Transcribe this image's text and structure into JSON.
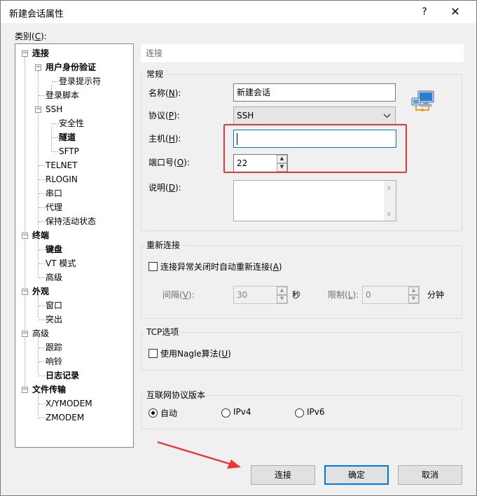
{
  "window": {
    "title": "新建会话属性",
    "help": "?",
    "close": "✕"
  },
  "category_label": {
    "text": "类别(",
    "key": "C",
    "tail": "):"
  },
  "tree": {
    "connection": "连接",
    "auth": "用户身份验证",
    "login_prompt": "登录提示符",
    "login_script": "登录脚本",
    "ssh": "SSH",
    "security": "安全性",
    "tunnel": "隧道",
    "sftp": "SFTP",
    "telnet": "TELNET",
    "rlogin": "RLOGIN",
    "serial": "串口",
    "proxy": "代理",
    "keepalive": "保持活动状态",
    "terminal": "终端",
    "keyboard": "键盘",
    "vt_mode": "VT 模式",
    "advanced1": "高级",
    "appearance": "外观",
    "window": "窗口",
    "highlight": "突出",
    "advanced2": "高级",
    "trace": "跟踪",
    "bell": "响铃",
    "logging": "日志记录",
    "file_transfer": "文件传输",
    "xymodem": "X/YMODEM",
    "zmodem": "ZMODEM"
  },
  "panel": {
    "header": "连接",
    "general": {
      "title": "常规",
      "name_label": {
        "text": "名称(",
        "key": "N",
        "tail": "):"
      },
      "name_value": "新建会话",
      "protocol_label": {
        "text": "协议(",
        "key": "P",
        "tail": "):"
      },
      "protocol_value": "SSH",
      "host_label": {
        "text": "主机(",
        "key": "H",
        "tail": "):"
      },
      "host_value": "",
      "port_label": {
        "text": "端口号(",
        "key": "O",
        "tail": "):"
      },
      "port_value": "22",
      "desc_label": {
        "text": "说明(",
        "key": "D",
        "tail": "):"
      },
      "desc_value": ""
    },
    "reconnect": {
      "title": "重新连接",
      "checkbox_label": {
        "text": "连接异常关闭时自动重新连接(",
        "key": "A",
        "tail": ")"
      },
      "checked": false,
      "interval_label": {
        "text": "间隔(",
        "key": "V",
        "tail": "):"
      },
      "interval_value": "30",
      "interval_unit": "秒",
      "limit_label": {
        "text": "限制(",
        "key": "L",
        "tail": "):"
      },
      "limit_value": "0",
      "limit_unit": "分钟"
    },
    "tcp": {
      "title": "TCP选项",
      "nagle_label": {
        "text": "使用Nagle算法(",
        "key": "U",
        "tail": ")"
      },
      "checked": false
    },
    "ip_version": {
      "title": "互联网协议版本",
      "options": [
        "自动",
        "IPv4",
        "IPv6"
      ],
      "selected": "自动"
    }
  },
  "buttons": {
    "connect": "连接",
    "ok": "确定",
    "cancel": "取消"
  },
  "colors": {
    "accent": "#0078d7",
    "annotation": "#e53935"
  }
}
